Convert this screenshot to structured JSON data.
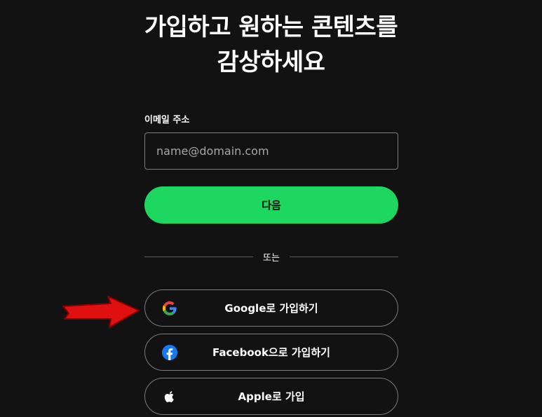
{
  "headline": {
    "line1": "가입하고 원하는 콘텐츠를",
    "line2": "감상하세요"
  },
  "email": {
    "label": "이메일 주소",
    "placeholder": "name@domain.com",
    "value": ""
  },
  "next_button": {
    "label": "다음"
  },
  "divider": {
    "text": "또는"
  },
  "social_buttons": [
    {
      "label": "Google로 가입하기",
      "icon": "google-icon"
    },
    {
      "label": "Facebook으로 가입하기",
      "icon": "facebook-icon"
    },
    {
      "label": "Apple로 가입",
      "icon": "apple-icon"
    }
  ],
  "annotation": {
    "icon": "red-arrow-icon",
    "color": "#e01010"
  },
  "colors": {
    "background": "#121212",
    "accent": "#1ed760",
    "border": "#7c7c7c",
    "facebook": "#1877f2"
  }
}
